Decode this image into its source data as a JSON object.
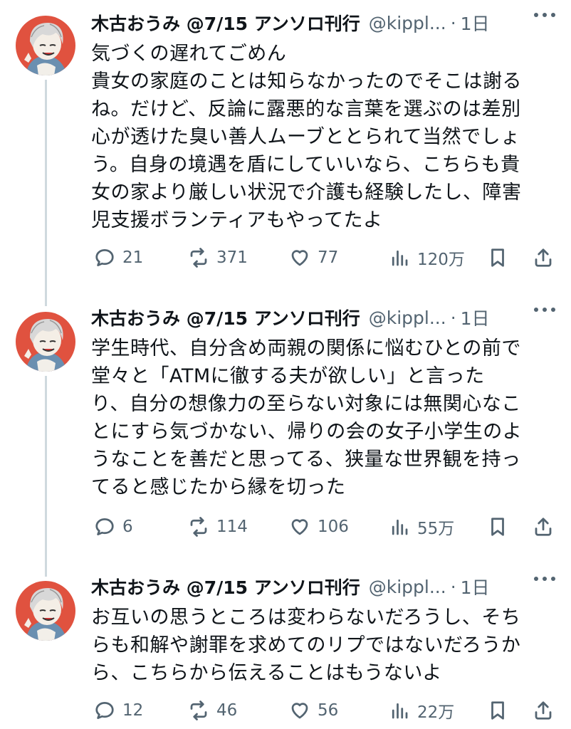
{
  "author": {
    "name": "木古おうみ @7/15 アンソロ刊行",
    "handle": "@kippl...",
    "separator": "·"
  },
  "tweets": [
    {
      "time": "1日",
      "lines": [
        "気づくの遅れてごめん",
        "貴女の家庭のことは知らなかったのでそこは謝る",
        "ね。だけど、反論に露悪的な言葉を選ぶのは差別",
        "心が透けた臭い善人ムーブととられて当然でしょ",
        "う。自身の境遇を盾にしていいなら、こちらも貴",
        "女の家より厳しい状況で介護も経験したし、障害",
        "児支援ボランティアもやってたよ"
      ],
      "replies": "21",
      "retweets": "371",
      "likes": "77",
      "views": "120万"
    },
    {
      "time": "1日",
      "lines": [
        "学生時代、自分含め両親の関係に悩むひとの前で",
        "堂々と「ATMに徹する夫が欲しい」と言った",
        "り、自分の想像力の至らない対象には無関心なこ",
        "とにすら気づかない、帰りの会の女子小学生のよ",
        "うなことを善だと思ってる、狭量な世界観を持っ",
        "てると感じたから縁を切った"
      ],
      "replies": "6",
      "retweets": "114",
      "likes": "106",
      "views": "55万"
    },
    {
      "time": "1日",
      "lines": [
        "お互いの思うところは変わらないだろうし、そち",
        "らも和解や謝罪を求めてのリプではないだろうか",
        "ら、こちらから伝えることはもうないよ"
      ],
      "replies": "12",
      "retweets": "46",
      "likes": "56",
      "views": "22万"
    }
  ],
  "icons": {
    "reply": "speech-bubble-icon",
    "retweet": "retweet-arrows-icon",
    "like": "heart-icon",
    "views": "bar-chart-icon",
    "bookmark": "bookmark-icon",
    "share": "share-upload-icon",
    "more": "ellipsis-icon"
  },
  "colors": {
    "text": "#0f1419",
    "secondary": "#536471",
    "thread_line": "#cfd9de",
    "avatar_bg": "#e0523f"
  }
}
